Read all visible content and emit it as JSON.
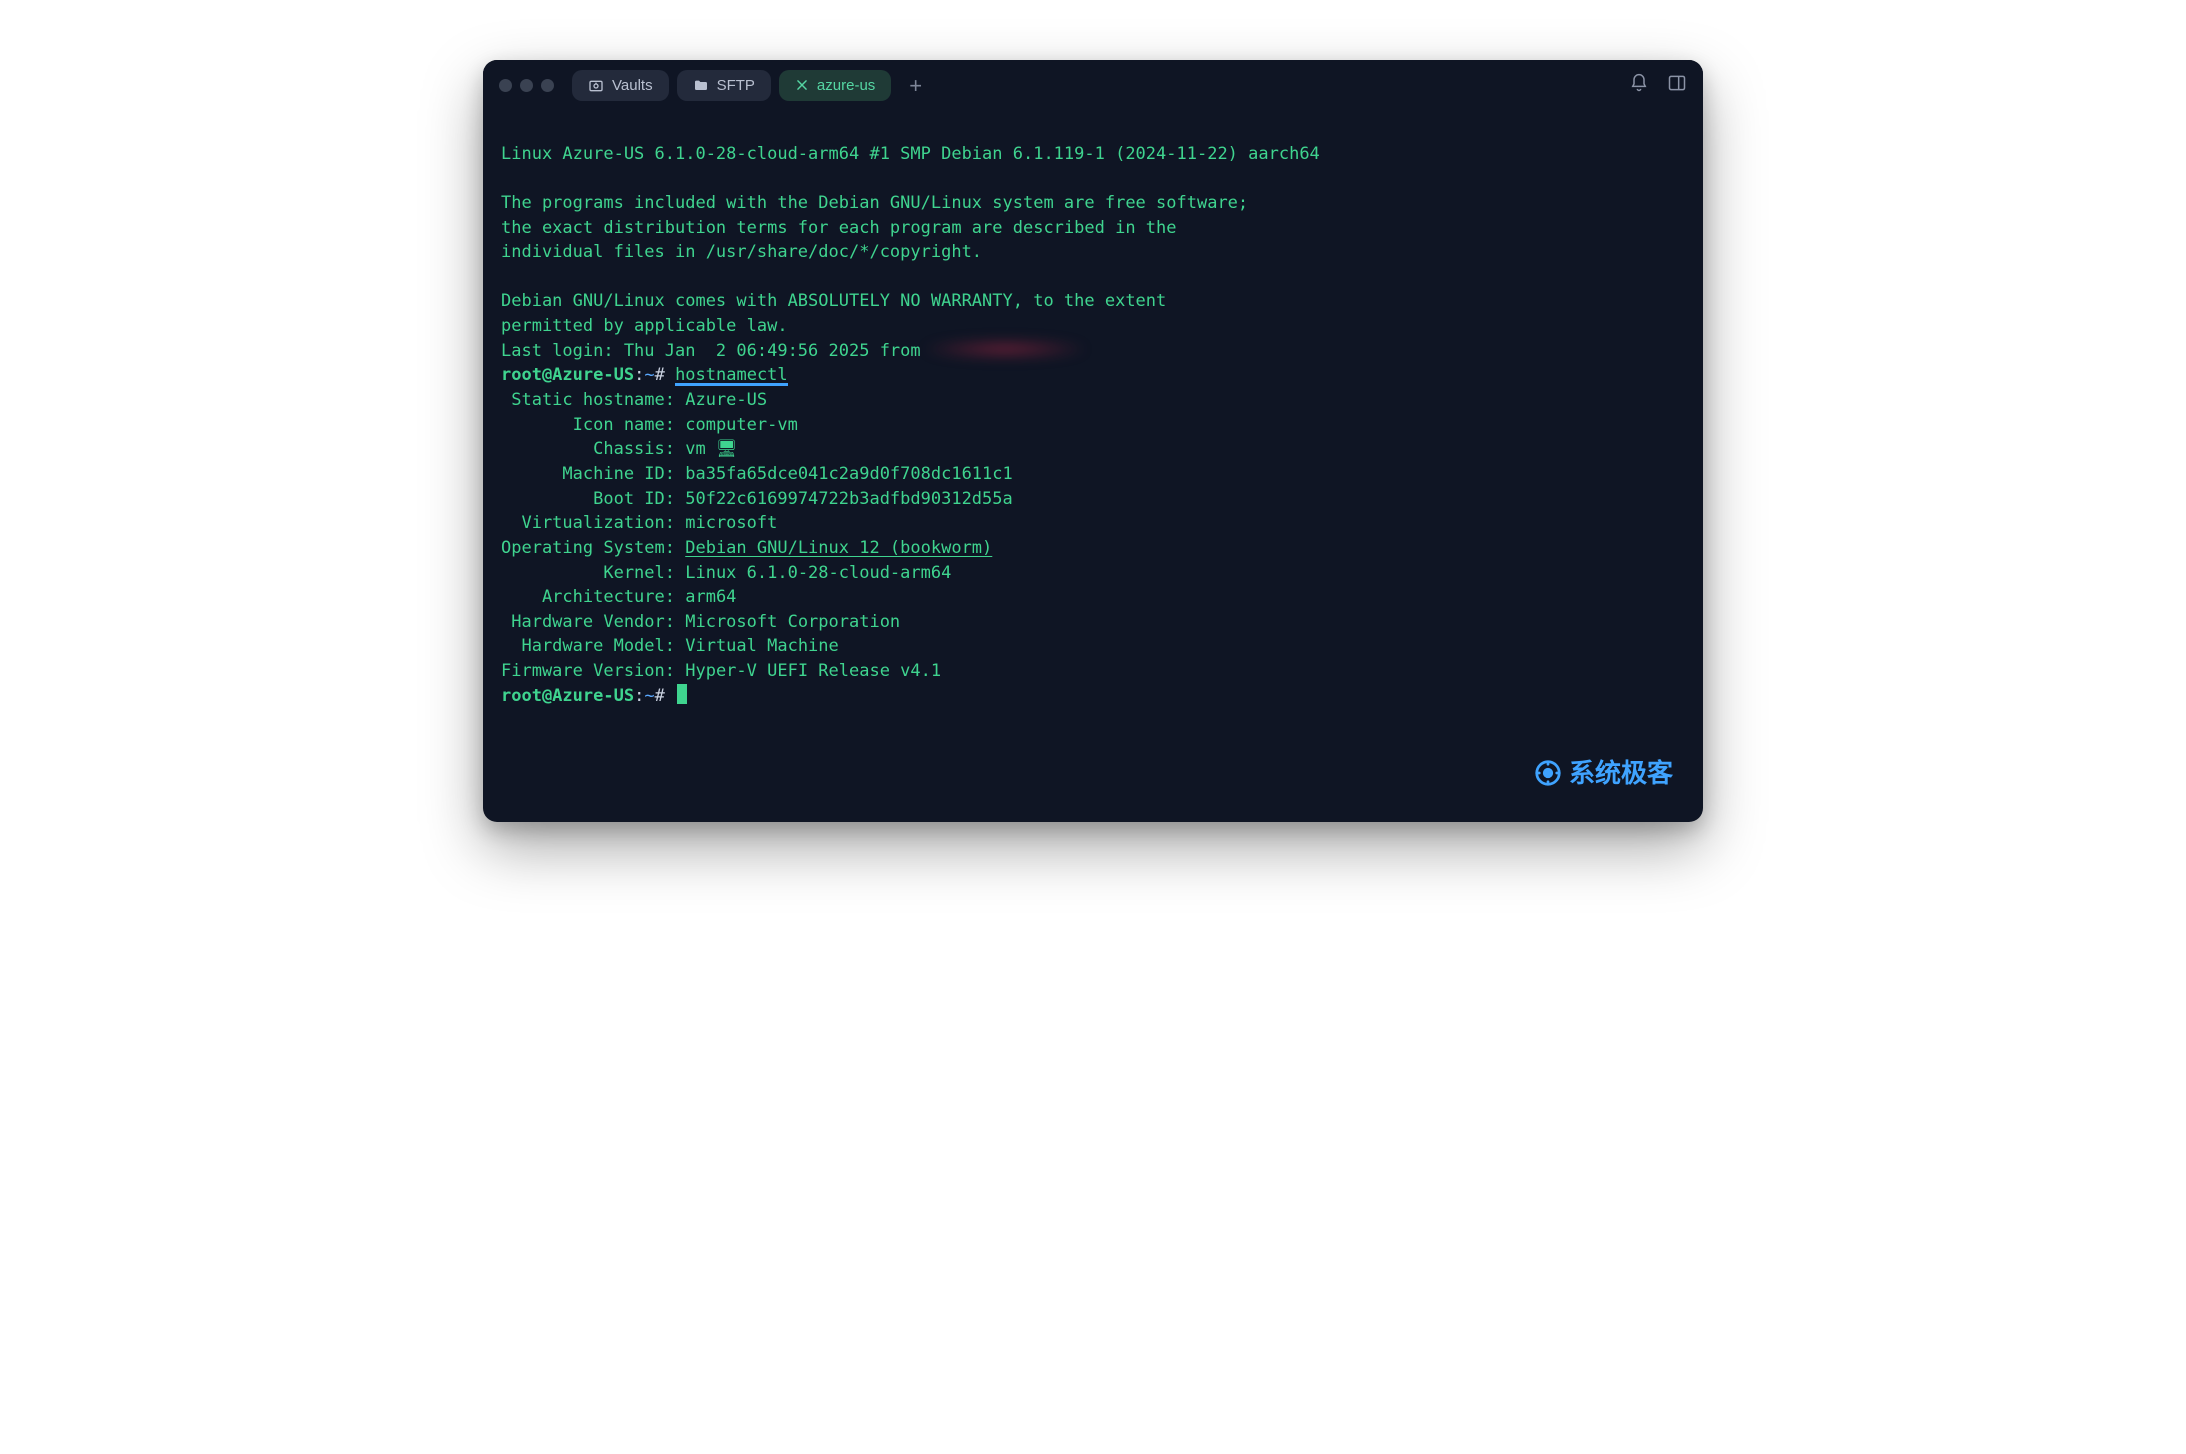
{
  "tabs": [
    {
      "label": "Vaults",
      "icon": "vault",
      "active": false
    },
    {
      "label": "SFTP",
      "icon": "folder",
      "active": false
    },
    {
      "label": "azure-us",
      "icon": "close",
      "active": true
    }
  ],
  "terminal": {
    "motd": [
      "Linux Azure-US 6.1.0-28-cloud-arm64 #1 SMP Debian 6.1.119-1 (2024-11-22) aarch64",
      "",
      "The programs included with the Debian GNU/Linux system are free software;",
      "the exact distribution terms for each program are described in the",
      "individual files in /usr/share/doc/*/copyright.",
      "",
      "Debian GNU/Linux comes with ABSOLUTELY NO WARRANTY, to the extent",
      "permitted by applicable law."
    ],
    "last_login_prefix": "Last login: Thu Jan  2 06:49:56 2025 from",
    "prompt_user_host": "root@Azure-US",
    "prompt_sep": ":",
    "prompt_path": "~",
    "prompt_symbol": "#",
    "command": "hostnamectl",
    "hostnamectl": [
      {
        "label": " Static hostname",
        "value": "Azure-US"
      },
      {
        "label": "       Icon name",
        "value": "computer-vm"
      },
      {
        "label": "         Chassis",
        "value": "vm 🖥"
      },
      {
        "label": "      Machine ID",
        "value": "ba35fa65dce041c2a9d0f708dc1611c1"
      },
      {
        "label": "         Boot ID",
        "value": "50f22c6169974722b3adfbd90312d55a"
      },
      {
        "label": "  Virtualization",
        "value": "microsoft"
      },
      {
        "label": "Operating System",
        "value": "Debian GNU/Linux 12 (bookworm)",
        "underline": true
      },
      {
        "label": "          Kernel",
        "value": "Linux 6.1.0-28-cloud-arm64"
      },
      {
        "label": "    Architecture",
        "value": "arm64"
      },
      {
        "label": " Hardware Vendor",
        "value": "Microsoft Corporation"
      },
      {
        "label": "  Hardware Model",
        "value": "Virtual Machine"
      },
      {
        "label": "Firmware Version",
        "value": "Hyper-V UEFI Release v4.1"
      }
    ]
  },
  "watermark": "系统极客"
}
